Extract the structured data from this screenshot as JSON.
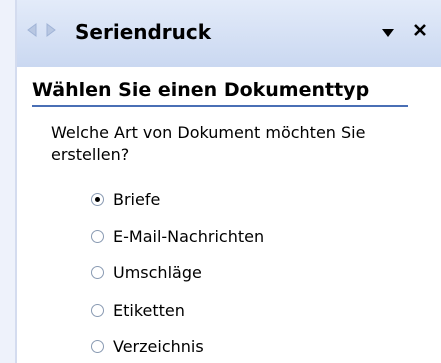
{
  "pane": {
    "title": "Seriendruck",
    "back_icon": "arrow-left-icon",
    "forward_icon": "arrow-right-icon",
    "menu_icon": "triangle-down-icon",
    "close_icon": "close-icon"
  },
  "section": {
    "heading": "Wählen Sie einen Dokumenttyp",
    "question": "Welche Art von Dokument möchten Sie erstellen?"
  },
  "options": [
    {
      "label": "Briefe",
      "selected": true
    },
    {
      "label": "E-Mail-Nachrichten",
      "selected": false
    },
    {
      "label": "Umschläge",
      "selected": false
    },
    {
      "label": "Etiketten",
      "selected": false
    },
    {
      "label": "Verzeichnis",
      "selected": false
    }
  ],
  "colors": {
    "accent_rule": "#4a6fb5",
    "titlebar": "#cad8f1"
  }
}
